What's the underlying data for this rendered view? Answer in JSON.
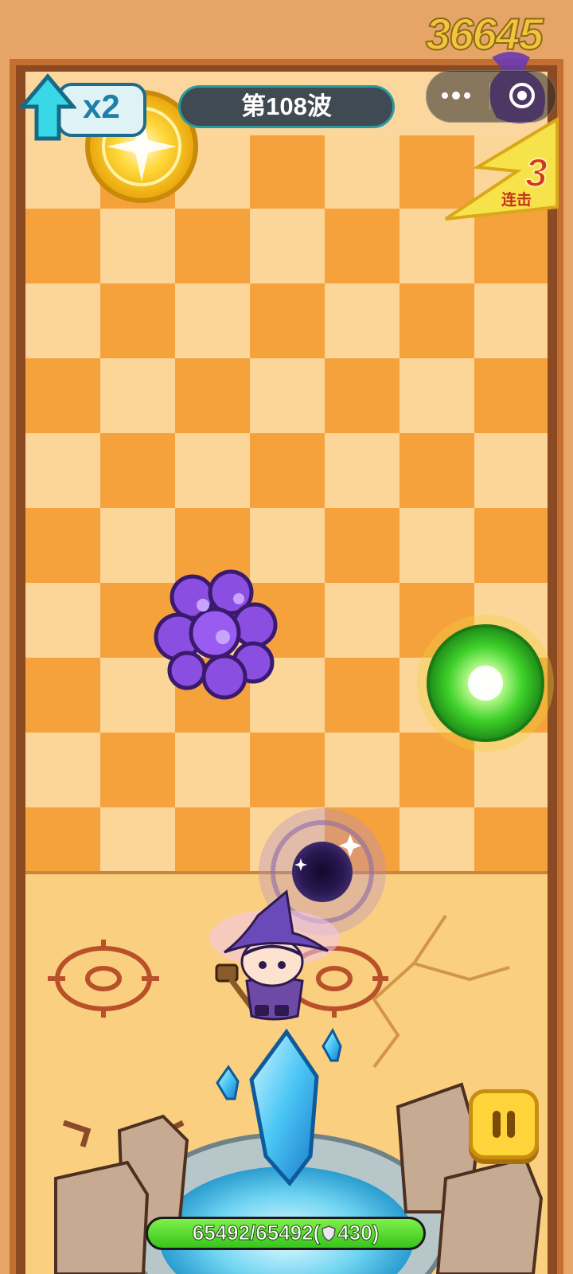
{
  "hud": {
    "damage_number": "36645",
    "multiplier": "x2",
    "wave_label": "第108波",
    "combo_count": "3",
    "combo_label": "连击"
  },
  "health": {
    "text": "65492/65492(",
    "shield": "430)",
    "current": 65492,
    "max": 65492
  },
  "colors": {
    "board_light": "#fcd598",
    "board_dark": "#f5a23d",
    "hp_green": "#38c41c",
    "pause_yellow": "#ffd43a"
  },
  "icons": [
    "up-arrow-icon",
    "more-dots-icon",
    "target-icon",
    "pause-icon",
    "shield-icon"
  ]
}
